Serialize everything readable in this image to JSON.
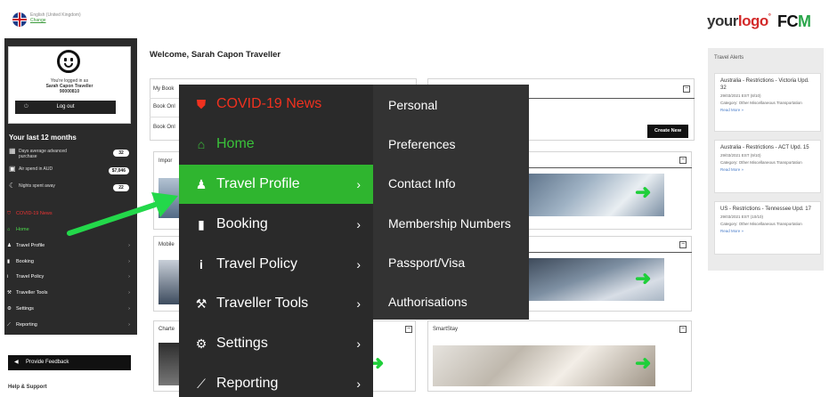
{
  "language": {
    "name": "English (United Kingdom)",
    "change": "Change"
  },
  "brand": {
    "your": "your",
    "logo_o": "logo",
    "reg": "°",
    "fcm_fc": "FC",
    "fcm_m": "M"
  },
  "profile": {
    "logged_in_as": "You're logged in as",
    "name": "Sarah Capon Traveller",
    "id": "90000810",
    "logout": "Log out"
  },
  "stats": {
    "heading": "Your last 12 months",
    "rows": [
      {
        "icon": "calendar-icon",
        "label": "Days average advanced purchase",
        "value": "32"
      },
      {
        "icon": "money-icon",
        "label": "Air spend in AUD",
        "value": "$7,046"
      },
      {
        "icon": "moon-icon",
        "label": "Nights spent away",
        "value": "22"
      }
    ]
  },
  "sidebar_menu": [
    {
      "label": "COVID-19 News",
      "icon": "shield-icon"
    },
    {
      "label": "Home",
      "icon": "home-icon"
    },
    {
      "label": "Travel Profile",
      "icon": "user-icon"
    },
    {
      "label": "Booking",
      "icon": "book-icon"
    },
    {
      "label": "Travel Policy",
      "icon": "info-icon"
    },
    {
      "label": "Traveller Tools",
      "icon": "wrench-icon"
    },
    {
      "label": "Settings",
      "icon": "gear-icon"
    },
    {
      "label": "Reporting",
      "icon": "chart-icon"
    }
  ],
  "feedback": "Provide Feedback",
  "help": "Help & Support",
  "welcome": "Welcome, Sarah Capon Traveller",
  "cards": {
    "my_bookings": "My Book",
    "book_online_1": "Book Onl",
    "book_online_2": "Book Onl",
    "create_new": "Create New",
    "important": "Impor",
    "mobile": "Mobile",
    "charter": "Charte",
    "smartstay": "SmartStay",
    "collapse": "−"
  },
  "alerts": {
    "title": "Travel Alerts",
    "items": [
      {
        "title": "Australia - Restrictions - Victoria Upd. 32",
        "date": "29/03/2021 EST  (8/10)",
        "category": "Category: Other Miscellaneous Transportation",
        "more": "Read More »"
      },
      {
        "title": "Australia - Restrictions - ACT Upd. 15",
        "date": "29/03/2021 EST  (9/10)",
        "category": "Category: Other Miscellaneous Transportation",
        "more": "Read More »"
      },
      {
        "title": "US - Restrictions - Tennessee Upd. 17",
        "date": "29/03/2021 EST  (10/10)",
        "category": "Category: Other Miscellaneous Transportation",
        "more": "Read More »"
      }
    ]
  },
  "overlay_menu": {
    "items": [
      {
        "label": "COVID-19 News",
        "icon": "shield-icon",
        "chevron": ""
      },
      {
        "label": "Home",
        "icon": "home-icon",
        "chevron": ""
      },
      {
        "label": "Travel Profile",
        "icon": "user-icon",
        "chevron": "›"
      },
      {
        "label": "Booking",
        "icon": "book-icon",
        "chevron": "›"
      },
      {
        "label": "Travel Policy",
        "icon": "info-icon",
        "chevron": "›"
      },
      {
        "label": "Traveller Tools",
        "icon": "wrench-icon",
        "chevron": "›"
      },
      {
        "label": "Settings",
        "icon": "gear-icon",
        "chevron": "›"
      },
      {
        "label": "Reporting",
        "icon": "chart-icon",
        "chevron": "›"
      }
    ],
    "submenu": [
      "Personal",
      "Preferences",
      "Contact Info",
      "Membership Numbers",
      "Passport/Visa",
      "Authorisations"
    ]
  },
  "colors": {
    "active_green": "#2fb52f",
    "covid_red": "#f0311f",
    "menu_bg": "#2a2a2a",
    "submenu_bg": "#333333"
  }
}
